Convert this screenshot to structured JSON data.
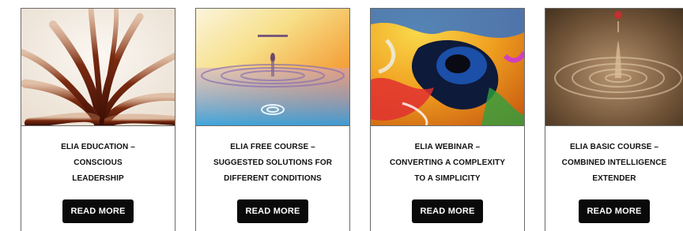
{
  "cards": [
    {
      "title_lines": [
        "ELIA EDUCATION –",
        "CONSCIOUS",
        "LEADERSHIP"
      ],
      "button_label": "READ MORE",
      "image_icon": "feathers-image"
    },
    {
      "title_lines": [
        "ELIA FREE COURSE –",
        "SUGGESTED SOLUTIONS FOR",
        "DIFFERENT CONDITIONS"
      ],
      "button_label": "READ MORE",
      "image_icon": "water-drop-image"
    },
    {
      "title_lines": [
        "ELIA WEBINAR –",
        "CONVERTING A COMPLEXITY",
        "TO A SIMPLICITY"
      ],
      "button_label": "READ MORE",
      "image_icon": "paint-splash-image"
    },
    {
      "title_lines": [
        "ELIA BASIC COURSE –",
        "COMBINED INTELLIGENCE",
        "EXTENDER"
      ],
      "button_label": "READ MORE",
      "image_icon": "ripple-drop-image"
    }
  ]
}
